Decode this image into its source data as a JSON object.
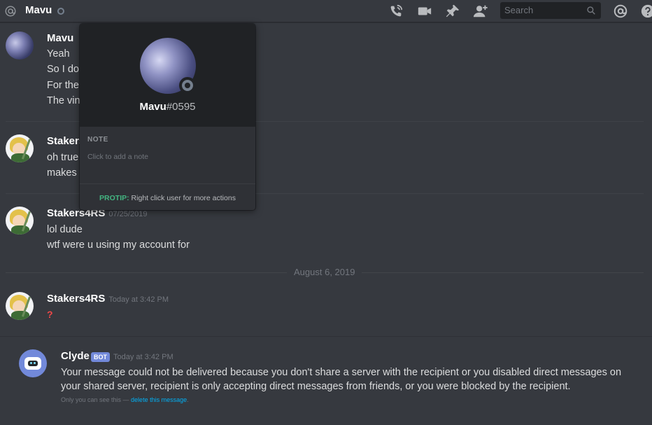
{
  "header": {
    "channel_name": "Mavu",
    "search_placeholder": "Search"
  },
  "messages": [
    {
      "username": "Mavu",
      "timestamp": "",
      "lines": [
        "Yeah",
        "So I don",
        "For the",
        "The vin"
      ]
    },
    {
      "username": "Stakers",
      "timestamp": "",
      "lines": [
        "oh true",
        "makes s"
      ]
    },
    {
      "username": "Stakers4RS",
      "timestamp": "07/25/2019",
      "lines": [
        "lol dude",
        "wtf were u using my account for"
      ]
    },
    {
      "username": "Stakers4RS",
      "timestamp": "Today at 3:42 PM",
      "lines": [
        "?"
      ]
    }
  ],
  "date_divider": "August 6, 2019",
  "clyde": {
    "username": "Clyde",
    "bot_tag": "BOT",
    "timestamp": "Today at 3:42 PM",
    "text": "Your message could not be delivered because you don't share a server with the recipient or you disabled direct messages on your shared server, recipient is only accepting direct messages from friends, or you were blocked by the recipient.",
    "note_prefix": "Only you can see this — ",
    "note_link": "delete this message",
    "note_suffix": "."
  },
  "popout": {
    "username": "Mavu",
    "discriminator": "#0595",
    "note_label": "NOTE",
    "note_placeholder": "Click to add a note",
    "protip_label": "PROTIP:",
    "protip_text": " Right click user for more actions"
  },
  "colors": {
    "background": "#36393f",
    "popout_header": "#202225",
    "protip_green": "#43b581",
    "link_blue": "#00b0f4",
    "blurple": "#7289da",
    "error_red": "#f04747"
  },
  "icons": [
    "at-icon",
    "status-offline-icon",
    "call-icon",
    "video-icon",
    "pin-icon",
    "add-friend-icon",
    "search-icon",
    "mentions-icon",
    "help-icon"
  ]
}
